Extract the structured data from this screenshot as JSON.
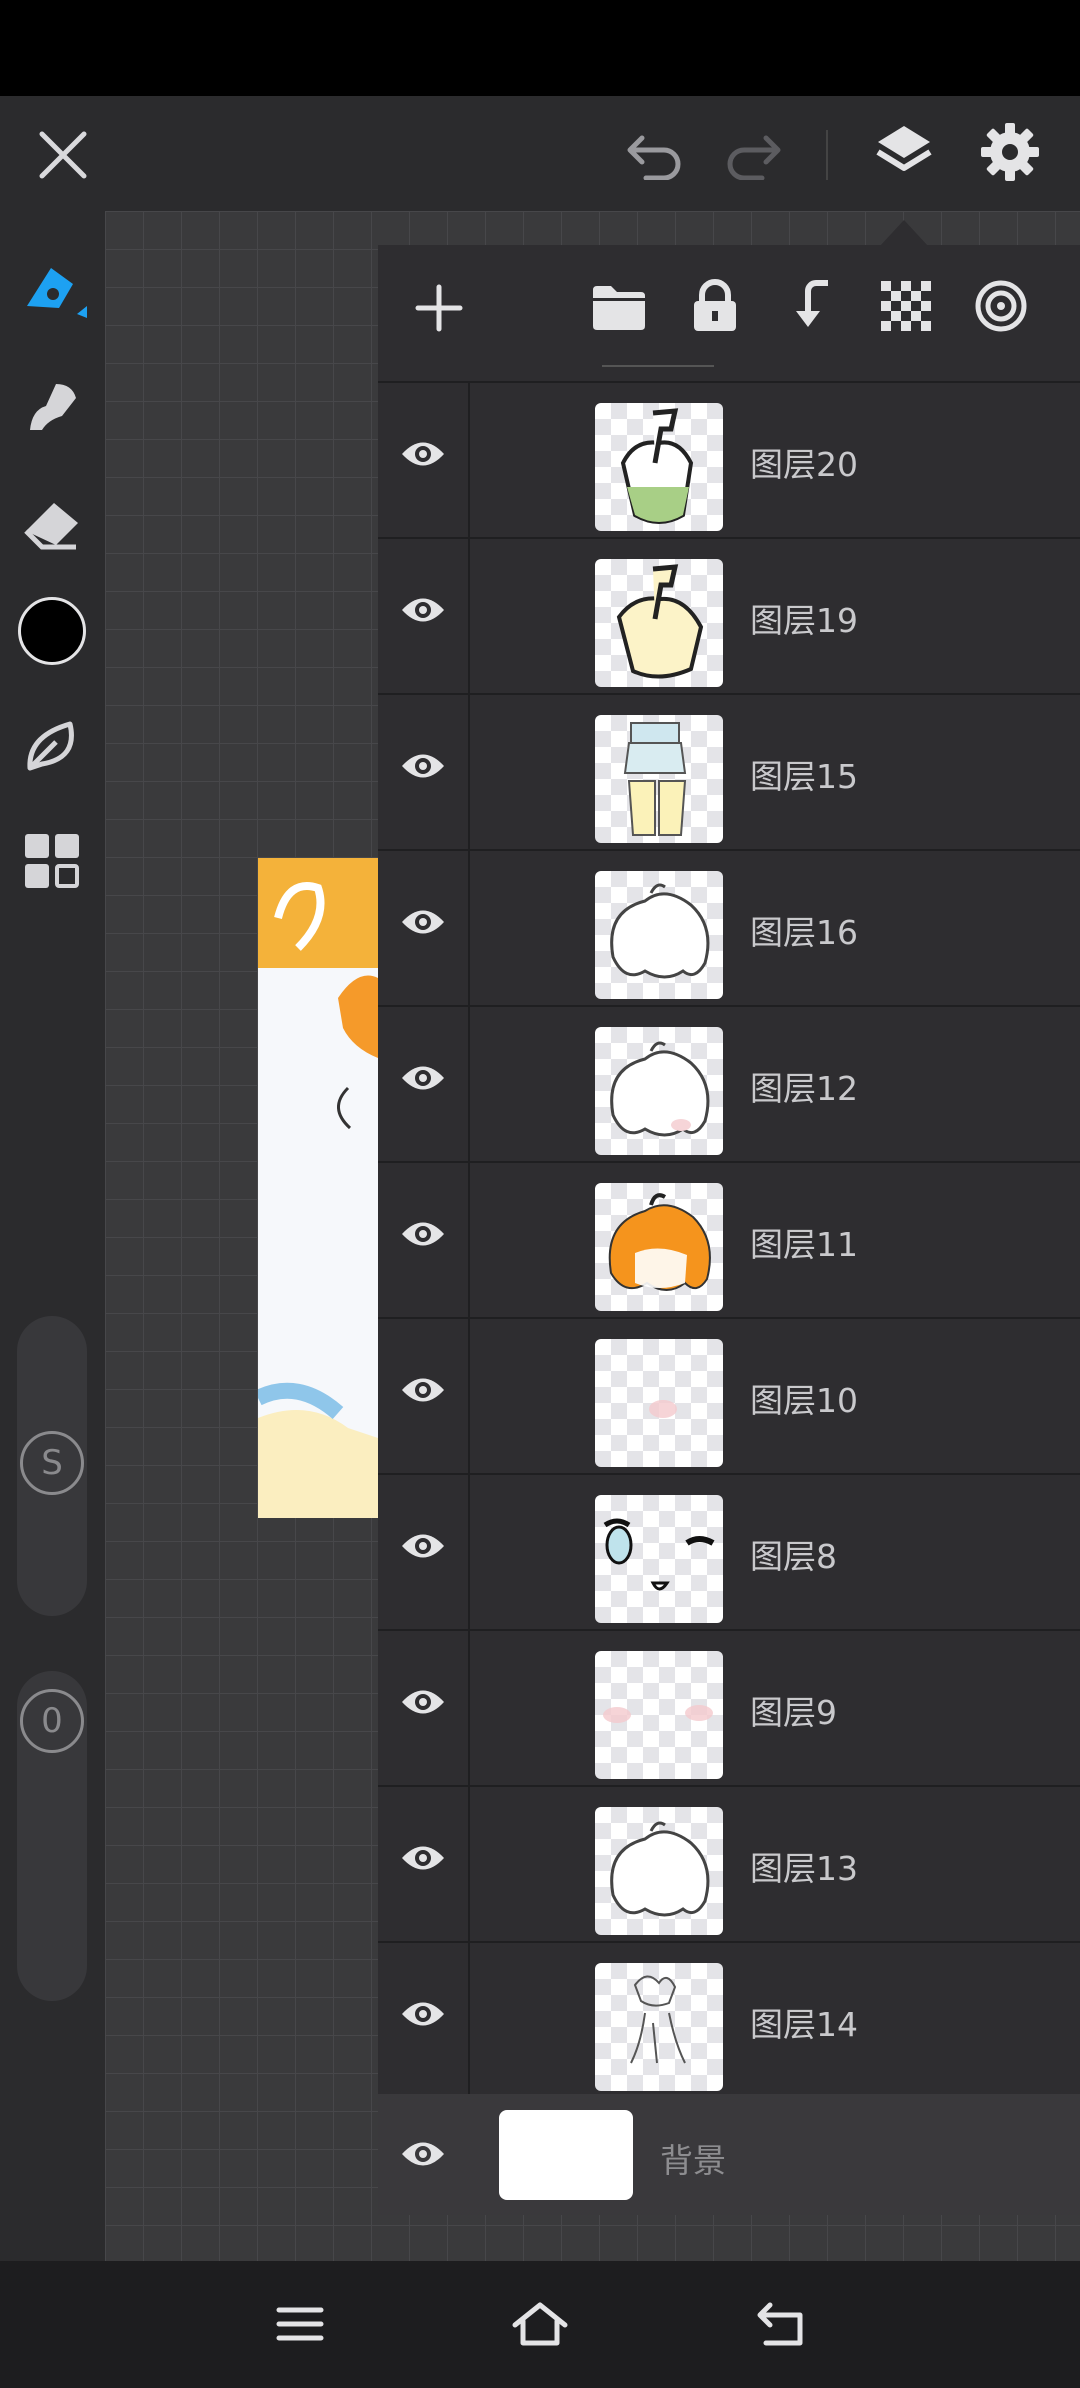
{
  "toolbar": {
    "close_icon": "close-icon",
    "undo_icon": "undo-icon",
    "redo_icon": "redo-icon",
    "layers_icon": "layers-icon",
    "settings_icon": "gear-icon"
  },
  "left_tools": {
    "active_color": "#1da1f2",
    "brush_color": "#000000",
    "size_slider_label": "S",
    "opacity_slider_label": "0"
  },
  "layer_panel": {
    "header_icons": [
      "add-icon",
      "folder-icon",
      "lock-icon",
      "merge-down-icon",
      "transparency-icon",
      "target-icon"
    ],
    "layers": [
      {
        "name": "图层20",
        "visible": true
      },
      {
        "name": "图层19",
        "visible": true
      },
      {
        "name": "图层15",
        "visible": true
      },
      {
        "name": "图层16",
        "visible": true
      },
      {
        "name": "图层12",
        "visible": true
      },
      {
        "name": "图层11",
        "visible": true
      },
      {
        "name": "图层10",
        "visible": true
      },
      {
        "name": "图层8",
        "visible": true
      },
      {
        "name": "图层9",
        "visible": true
      },
      {
        "name": "图层13",
        "visible": true
      },
      {
        "name": "图层14",
        "visible": true
      }
    ],
    "background": {
      "name": "背景",
      "visible": true
    }
  },
  "navbar": {
    "icons": [
      "menu-icon",
      "home-icon",
      "back-icon"
    ]
  }
}
